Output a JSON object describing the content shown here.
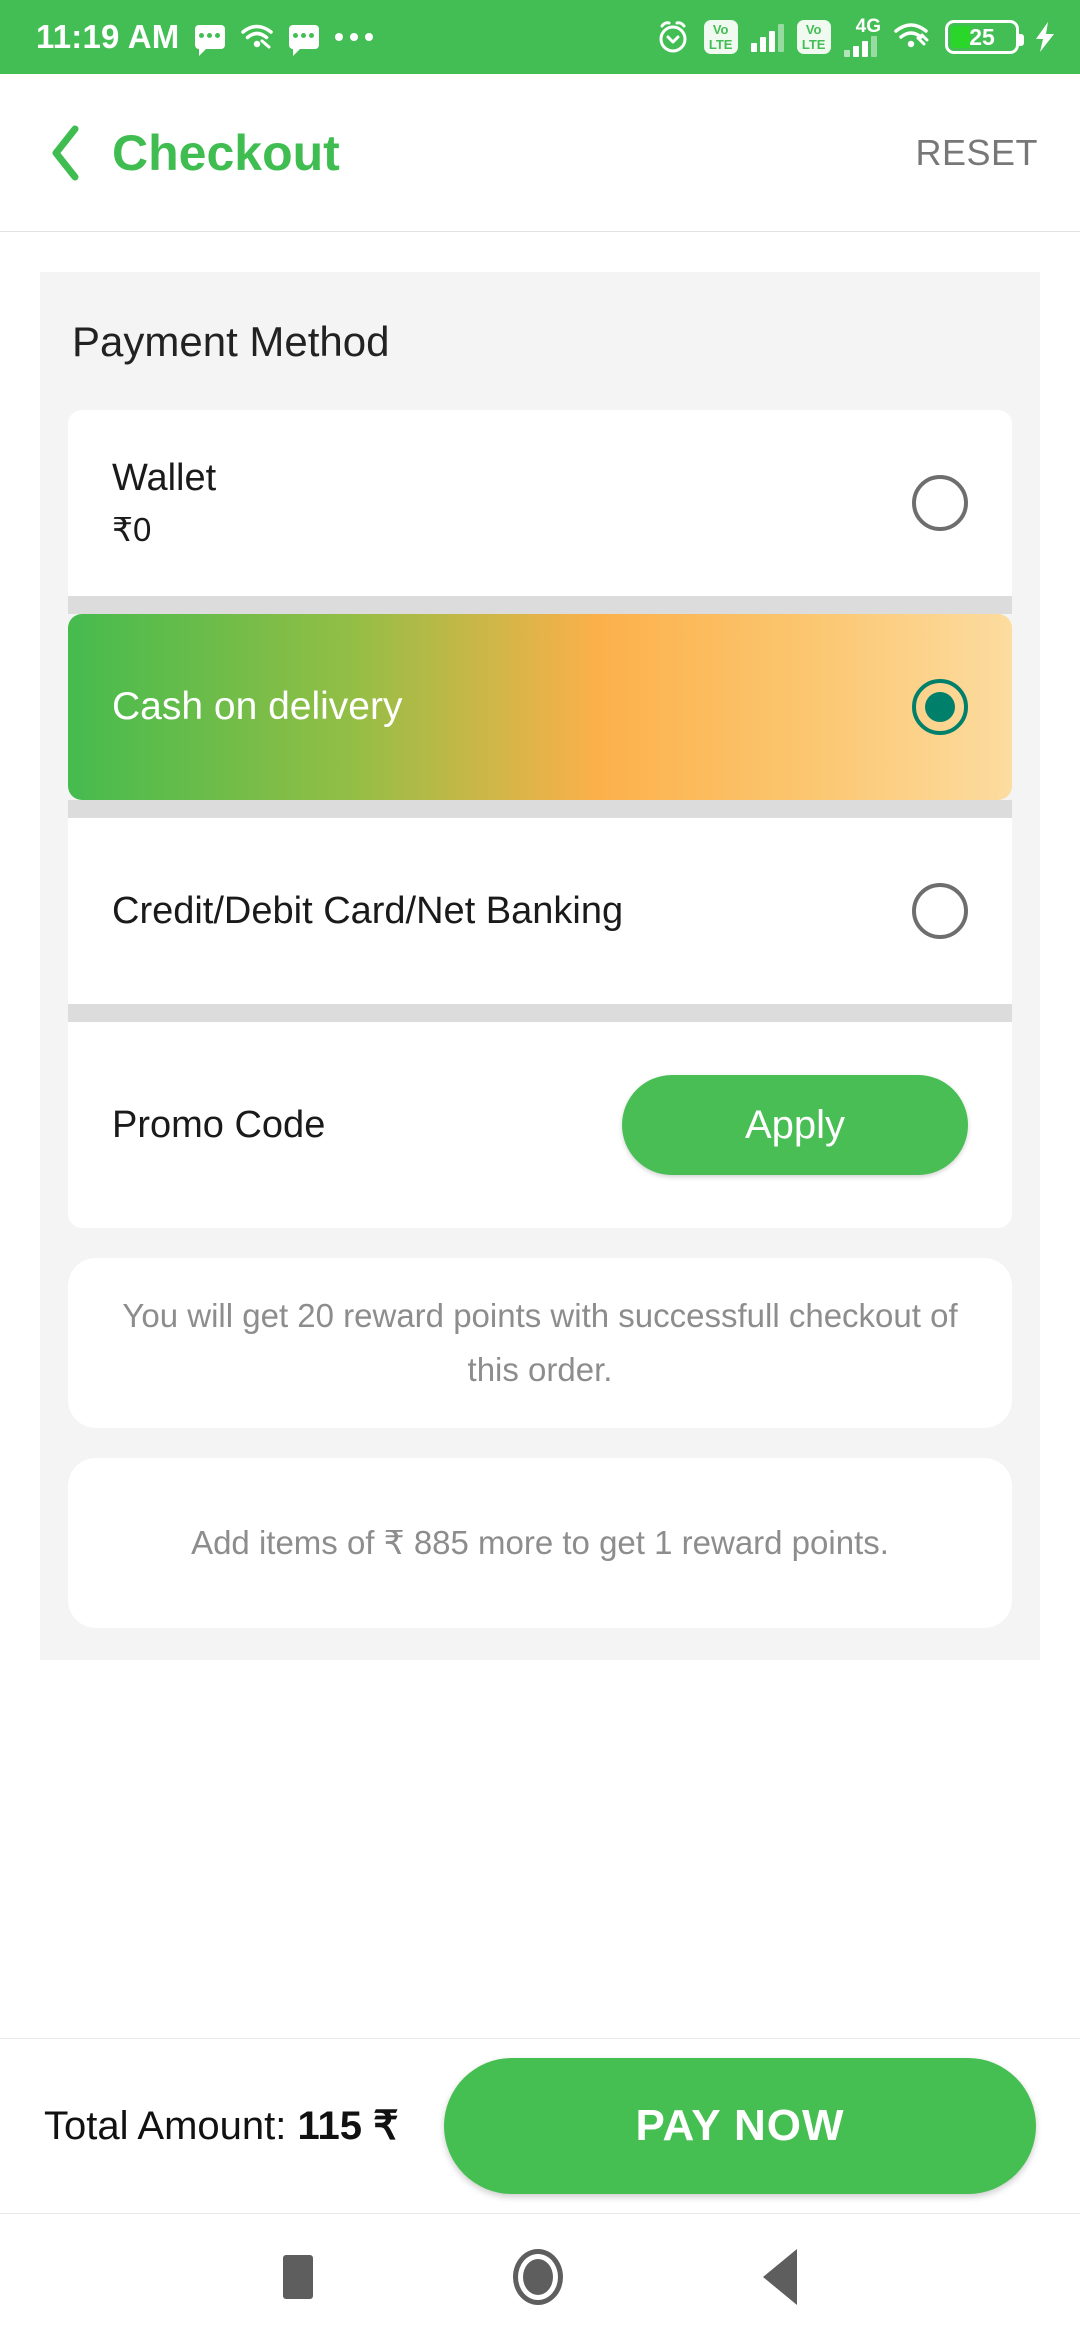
{
  "statusbar": {
    "time": "11:19 AM",
    "icons": [
      "message-icon",
      "wifi-tethering-icon",
      "message-icon",
      "more-dots-icon",
      "alarm-icon",
      "volte-icon",
      "signal-bars-icon",
      "volte-icon",
      "4g-signal-icon",
      "wifi-link-icon",
      "battery-icon",
      "charging-bolt-icon"
    ],
    "volte_top": "Vo",
    "volte_bottom": "LTE",
    "network_4g": "4G",
    "battery_level": "25",
    "bar_color": "#43BE54"
  },
  "header": {
    "back_icon": "chevron-left-icon",
    "title": "Checkout",
    "reset_label": "RESET",
    "title_color": "#3FBD51"
  },
  "payment": {
    "section_title": "Payment Method",
    "methods": [
      {
        "label": "Wallet",
        "sub": "₹0",
        "selected": false
      },
      {
        "label": "Cash on delivery",
        "sub": "",
        "selected": true
      },
      {
        "label": "Credit/Debit Card/Net Banking",
        "sub": "",
        "selected": false
      }
    ],
    "selected_gradient_from": "#45BB4E",
    "selected_gradient_to": "#FCDCA0",
    "radio_selected_color": "#00806B"
  },
  "promo": {
    "placeholder": "Promo Code",
    "apply_label": "Apply",
    "apply_color": "#48BE54"
  },
  "notices": [
    "You will get 20 reward points with successfull checkout of this order.",
    "Add items of ₹ 885 more to get 1 reward points."
  ],
  "footer": {
    "total_prefix": "Total Amount: ",
    "total_value": "115 ₹",
    "pay_label": "PAY NOW",
    "pay_color": "#45BE52"
  },
  "navbar": {
    "recents": "square-icon",
    "home": "circle-icon",
    "back": "triangle-back-icon"
  }
}
